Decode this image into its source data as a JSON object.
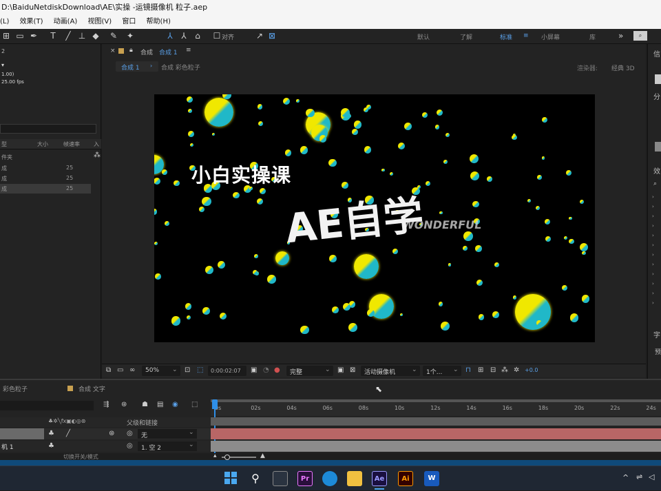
{
  "window": {
    "title": "D:\\BaiduNetdiskDownload\\AE\\实操 -运镜摄像机 粒子.aep"
  },
  "menu": [
    "(L)",
    "效果(T)",
    "动画(A)",
    "视图(V)",
    "窗口",
    "帮助(H)"
  ],
  "toolbar": {
    "align_label": "对齐",
    "workspaces": [
      "默认",
      "了解",
      "标准",
      "小屏幕",
      "库"
    ]
  },
  "left_panel": {
    "comp_info": [
      "2",
      "▾",
      "1.00)",
      "25.00 fps"
    ],
    "columns": [
      "型",
      "大小",
      "帧速率",
      "入"
    ],
    "rows": [
      {
        "name": "件夹",
        "fps": ""
      },
      {
        "name": "成",
        "fps": "25"
      },
      {
        "name": "成",
        "fps": "25"
      },
      {
        "name": "成",
        "fps": "25"
      }
    ]
  },
  "comp": {
    "tab_label": "合成",
    "tab_name": "合成 1",
    "breadcrumbs": [
      "合成 1",
      "合成 彩色粒子"
    ],
    "renderer_label": "渲染器:",
    "renderer_value": "经典 3D"
  },
  "viewer": {
    "title_small": "小白实操课",
    "title_large": "AE自学",
    "ghost_text": "WONDERFUL",
    "particle_colors": [
      "#f0e800",
      "#20b8c8"
    ]
  },
  "viewer_bar": {
    "zoom": "50%",
    "timecode": "0:00:02:07",
    "quality": "完整",
    "camera": "活动摄像机",
    "views": "1个...",
    "exposure": "+0.0"
  },
  "timeline": {
    "tabs": [
      "彩色粒子",
      "合成 文字"
    ],
    "ruler": [
      "0s",
      "02s",
      "04s",
      "06s",
      "08s",
      "10s",
      "12s",
      "14s",
      "16s",
      "18s",
      "20s",
      "22s",
      "24s"
    ],
    "parent_header": "父级和链接",
    "layers": [
      {
        "name": "",
        "parent": "无"
      },
      {
        "name": "机 1",
        "parent": "1. 空 2"
      }
    ],
    "footer_label": "切换开关/模式"
  },
  "taskbar": {
    "apps": [
      {
        "name": "windows-start",
        "label": ""
      },
      {
        "name": "search",
        "label": ""
      },
      {
        "name": "task-view",
        "label": ""
      },
      {
        "name": "premiere",
        "label": "Pr"
      },
      {
        "name": "edge",
        "label": ""
      },
      {
        "name": "file-explorer",
        "label": ""
      },
      {
        "name": "after-effects",
        "label": "Ae"
      },
      {
        "name": "illustrator",
        "label": "Ai"
      },
      {
        "name": "word",
        "label": "W"
      }
    ]
  },
  "right_panel": {
    "letters": [
      "信",
      "分",
      "效",
      "字",
      "预"
    ]
  }
}
